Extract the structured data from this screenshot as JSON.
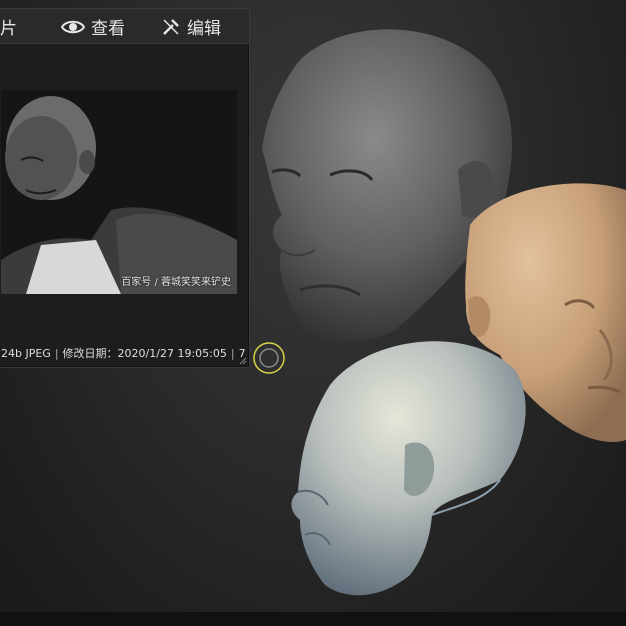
{
  "viewer": {
    "toolbar": {
      "photos_label": "相片",
      "view_label": "查看",
      "edit_label": "编辑"
    },
    "image_watermark": "百家号 / 蓉城笑笑来铲史",
    "status": {
      "file_info": "24b JPEG",
      "modified": "修改日期：2020/1/27 19:05:05",
      "trailing": "7"
    }
  },
  "icons": {
    "view": "eye-icon",
    "edit": "edit-tools-icon",
    "cursor": "brush-cursor-icon"
  },
  "colors": {
    "background": "#2c2c2c",
    "head_grey": "#5d5d5d",
    "head_skin": "#c9a47e",
    "head_blue": "#aeb6b8",
    "cursor_ring": "#d8d24a"
  }
}
